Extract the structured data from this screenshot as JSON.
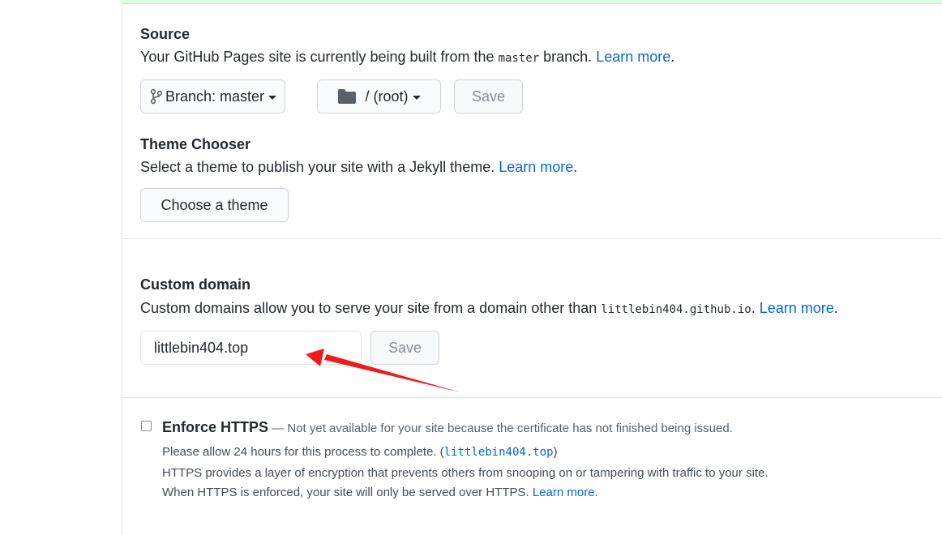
{
  "source": {
    "title": "Source",
    "desc_before": "Your GitHub Pages site is currently being built from the ",
    "branch_code": "master",
    "desc_after": " branch. ",
    "learn_more": "Learn more",
    "period": ".",
    "branch_button_prefix": "Branch: ",
    "branch_button_value": "master",
    "folder_button_label": "/ (root)",
    "save_label": "Save"
  },
  "theme": {
    "title": "Theme Chooser",
    "desc": "Select a theme to publish your site with a Jekyll theme. ",
    "learn_more": "Learn more",
    "period": ".",
    "choose_label": "Choose a theme"
  },
  "custom_domain": {
    "title": "Custom domain",
    "desc": "Custom domains allow you to serve your site from a domain other than ",
    "domain_code": "littlebin404.github.io",
    "period_after_code": ". ",
    "learn_more": "Learn more",
    "period": ".",
    "input_value": "littlebin404.top",
    "save_label": "Save"
  },
  "https": {
    "label": "Enforce HTTPS",
    "status": " — Not yet available for your site because the certificate has not finished being issued.",
    "line2_before": "Please allow 24 hours for this process to complete. (",
    "line2_code": "littlebin404.top",
    "line2_after": ")",
    "line3": "HTTPS provides a layer of encryption that prevents others from snooping on or tampering with traffic to your site.",
    "line4": "When HTTPS is enforced, your site will only be served over HTTPS. ",
    "learn_more": "Learn more",
    "period": "."
  },
  "annotation": {
    "arrow_color": "#f31a1a"
  }
}
